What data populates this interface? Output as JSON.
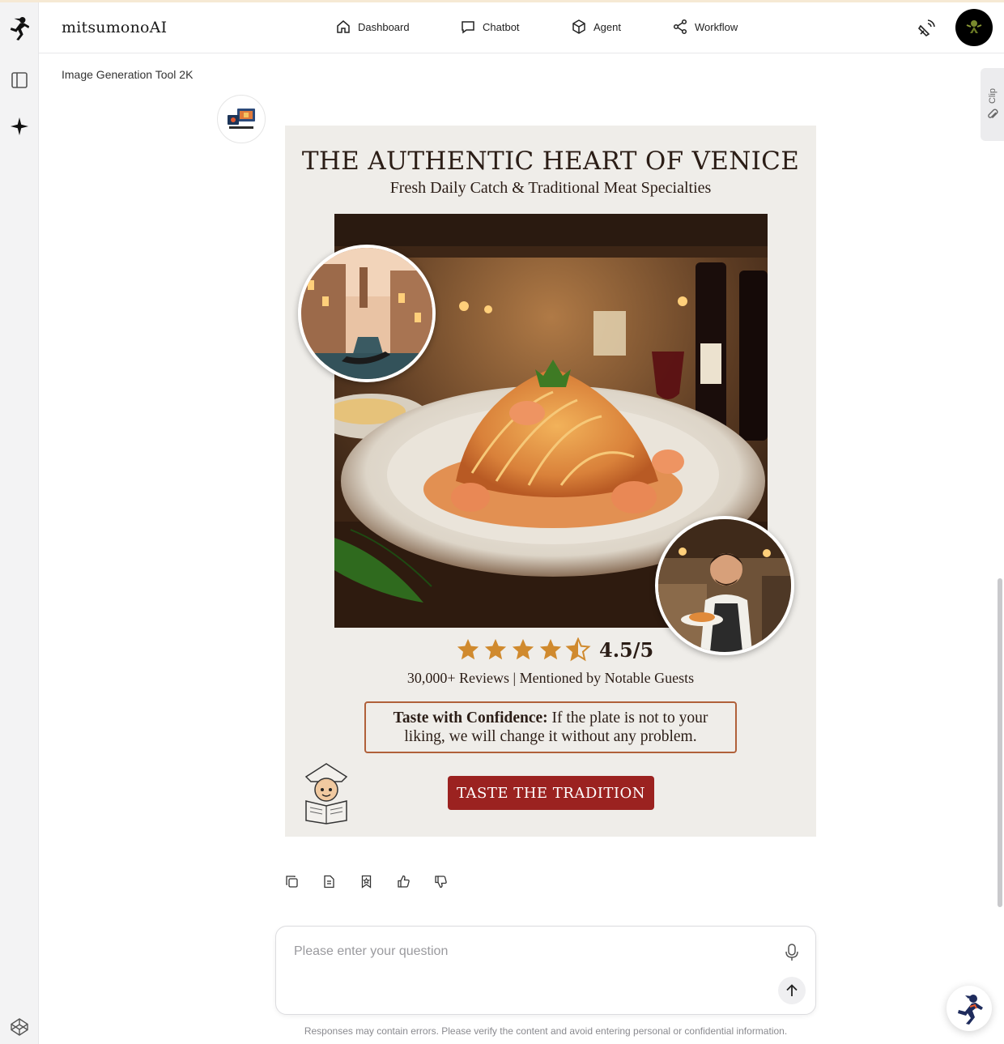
{
  "app": {
    "brand": "mitsumonoAI"
  },
  "nav": {
    "dashboard": "Dashboard",
    "chatbot": "Chatbot",
    "agent": "Agent",
    "workflow": "Workflow"
  },
  "page": {
    "subtitle": "Image Generation Tool 2K"
  },
  "clip": {
    "label": "Clip"
  },
  "poster": {
    "title": "THE AUTHENTIC HEART OF VENICE",
    "subtitle": "Fresh Daily Catch & Traditional Meat Specialties",
    "rating_text": "4.5/5",
    "rating_value": 4.5,
    "rating_max": 5,
    "reviews": "30,000+ Reviews | Mentioned by Notable Guests",
    "guarantee_bold": "Taste with Confidence:",
    "guarantee_text": " If the plate is not to your liking, we will change it without any problem.",
    "cta": "TASTE THE TRADITION"
  },
  "input": {
    "placeholder": "Please enter your question"
  },
  "disclaimer": "Responses may contain errors. Please verify the content and avoid entering personal or confidential information.",
  "colors": {
    "cta": "#9b2220",
    "star": "#d08a2e",
    "frame": "#b0603a",
    "poster_bg": "#efede9"
  },
  "icons": {
    "rail": [
      "logo-ninja-icon",
      "sidebar-toggle-icon",
      "sparkle-icon",
      "codepen-icon"
    ],
    "actions": [
      "copy-icon",
      "document-icon",
      "bookmark-icon",
      "thumbs-up-icon",
      "thumbs-down-icon"
    ]
  }
}
